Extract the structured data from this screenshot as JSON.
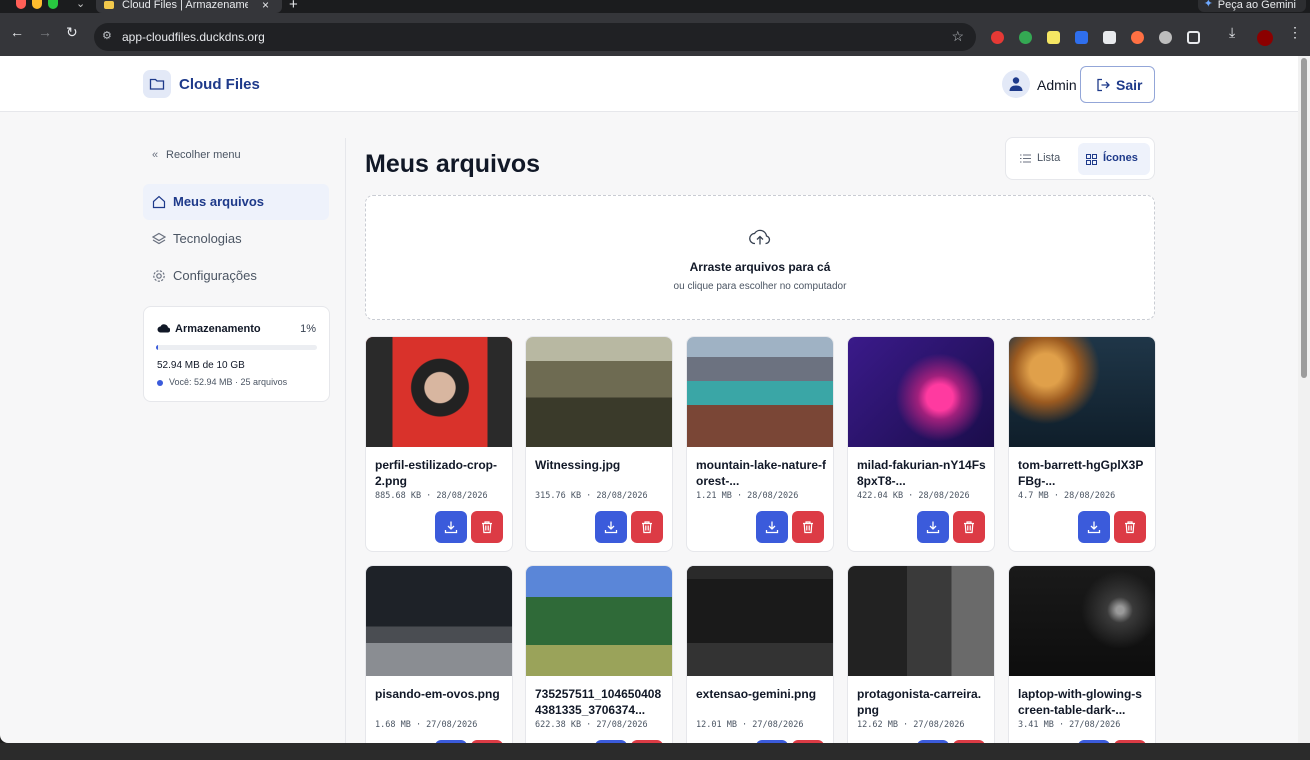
{
  "browser": {
    "tab_title": "Cloud Files | Armazenamento",
    "url": "app-cloudfiles.duckdns.org",
    "gemini_label": "Peça ao Gemini"
  },
  "app": {
    "name": "Cloud Files",
    "user_name": "Admin",
    "logout_label": "Sair"
  },
  "sidebar": {
    "collapse_label": "Recolher menu",
    "items": [
      {
        "label": "Meus arquivos",
        "icon": "home-icon",
        "active": true
      },
      {
        "label": "Tecnologias",
        "icon": "layers-icon",
        "active": false
      },
      {
        "label": "Configurações",
        "icon": "gear-icon",
        "active": false
      }
    ],
    "storage": {
      "title": "Armazenamento",
      "percent_label": "1%",
      "used_fraction": 0.0053,
      "used_label": "52.94 MB de 10 GB",
      "you_label": "Você: 52.94 MB · 25 arquivos"
    }
  },
  "main": {
    "title": "Meus arquivos",
    "view_list_label": "Lista",
    "view_icons_label": "Ícones",
    "dropzone_title": "Arraste arquivos para cá",
    "dropzone_subtitle": "ou clique para escolher no computador"
  },
  "files": [
    {
      "name": "perfil-estilizado-crop-2.png",
      "meta": "885.68 KB · 28/08/2026",
      "thumb": "portrait-red"
    },
    {
      "name": "Witnessing.jpg",
      "meta": "315.76 KB · 28/08/2026",
      "thumb": "anime-town"
    },
    {
      "name": "mountain-lake-nature-forest-...",
      "meta": "1.21 MB · 28/08/2026",
      "thumb": "mountain-lake"
    },
    {
      "name": "milad-fakurian-nY14Fs8pxT8-...",
      "meta": "422.04 KB · 28/08/2026",
      "thumb": "abstract-purple"
    },
    {
      "name": "tom-barrett-hgGplX3PFBg-...",
      "meta": "4.7 MB · 28/08/2026",
      "thumb": "clouds-sunset"
    },
    {
      "name": "pisando-em-ovos.png",
      "meta": "1.68 MB · 27/08/2026",
      "thumb": "dark-street"
    },
    {
      "name": "735257511_1046504084381335_3706374...",
      "meta": "622.38 KB · 27/08/2026",
      "thumb": "forest-road"
    },
    {
      "name": "extensao-gemini.png",
      "meta": "12.01 MB · 27/08/2026",
      "thumb": "screen-grid"
    },
    {
      "name": "protagonista-carreira.png",
      "meta": "12.62 MB · 27/08/2026",
      "thumb": "speaker-photo"
    },
    {
      "name": "laptop-with-glowing-screen-table-dark-...",
      "meta": "3.41 MB · 27/08/2026",
      "thumb": "dark-laptop"
    }
  ],
  "labels": {
    "download": "download-icon",
    "delete": "trash-icon"
  }
}
